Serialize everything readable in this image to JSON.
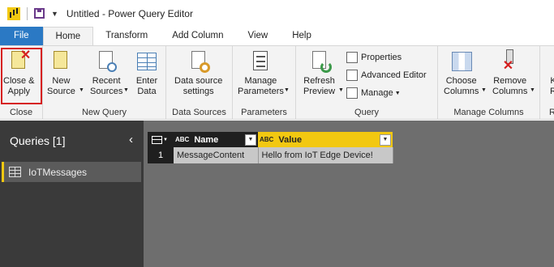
{
  "window": {
    "title": "Untitled - Power Query Editor"
  },
  "tabs": [
    {
      "label": "File"
    },
    {
      "label": "Home"
    },
    {
      "label": "Transform"
    },
    {
      "label": "Add Column"
    },
    {
      "label": "View"
    },
    {
      "label": "Help"
    }
  ],
  "ribbon": {
    "close": {
      "button": "Close &\nApply",
      "group": "Close"
    },
    "new_query": {
      "new_source": "New\nSource",
      "recent_sources": "Recent\nSources",
      "enter_data": "Enter\nData",
      "group": "New Query"
    },
    "data_sources": {
      "settings": "Data source\nsettings",
      "group": "Data Sources"
    },
    "parameters": {
      "manage": "Manage\nParameters",
      "group": "Parameters"
    },
    "query": {
      "refresh": "Refresh\nPreview",
      "properties": "Properties",
      "advanced_editor": "Advanced Editor",
      "manage": "Manage",
      "group": "Query"
    },
    "manage_columns": {
      "choose": "Choose\nColumns",
      "remove": "Remove\nColumns",
      "group": "Manage Columns"
    },
    "partial": {
      "label": "K\nR",
      "group": "R"
    }
  },
  "queries_pane": {
    "title": "Queries [1]",
    "items": [
      {
        "label": "IoTMessages"
      }
    ]
  },
  "table": {
    "columns": [
      {
        "type": "ABC",
        "name": "Name"
      },
      {
        "type": "ABC",
        "name": "Value"
      }
    ],
    "rows": [
      {
        "index": "1",
        "cells": [
          "MessageContent",
          "Hello from IoT Edge Device!"
        ]
      }
    ]
  }
}
